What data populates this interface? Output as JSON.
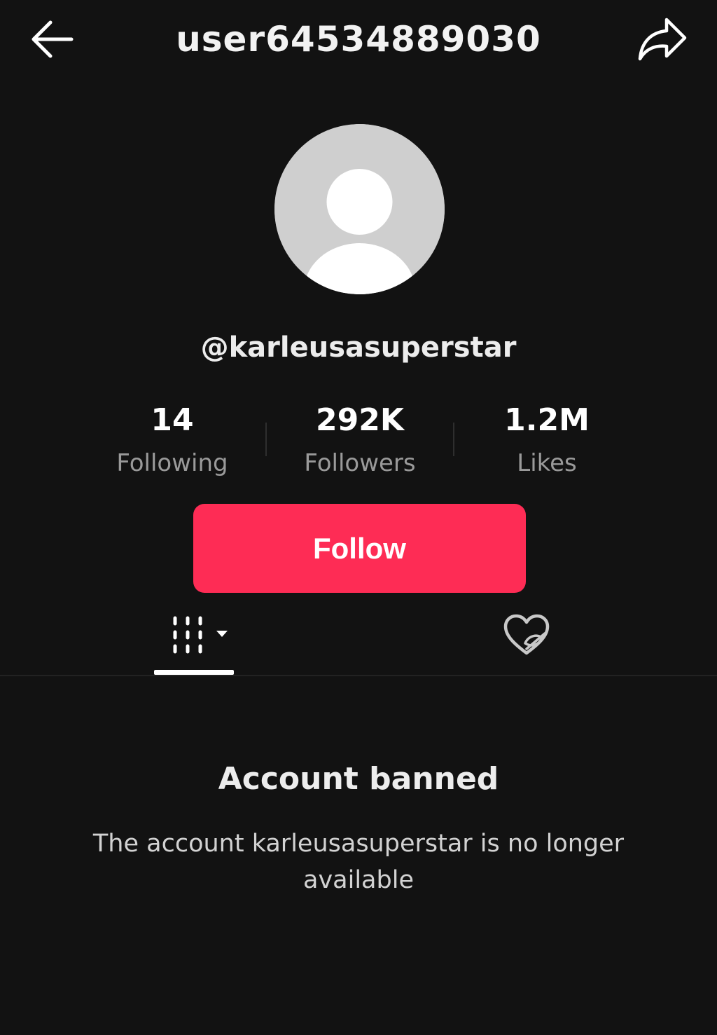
{
  "header": {
    "title": "user64534889030",
    "back_icon": "arrow-left-icon",
    "share_icon": "share-arrow-icon"
  },
  "profile": {
    "avatar_icon": "default-avatar-icon",
    "handle": "@karleusasuperstar"
  },
  "stats": [
    {
      "value": "14",
      "label": "Following"
    },
    {
      "value": "292K",
      "label": "Followers"
    },
    {
      "value": "1.2M",
      "label": "Likes"
    }
  ],
  "actions": {
    "follow_label": "Follow"
  },
  "tabs": [
    {
      "name": "videos",
      "icon": "video-grid-icon",
      "dropdown_icon": "caret-down-icon",
      "active": true
    },
    {
      "name": "liked",
      "icon": "liked-hidden-heart-icon",
      "active": false
    }
  ],
  "notice": {
    "title": "Account banned",
    "message": "The account karleusasuperstar is no longer available"
  },
  "colors": {
    "background": "#121212",
    "follow_button": "#fe2c55",
    "text_primary": "#ffffff",
    "text_secondary": "#9a9a9a",
    "avatar_bg": "#cfcfcf"
  }
}
